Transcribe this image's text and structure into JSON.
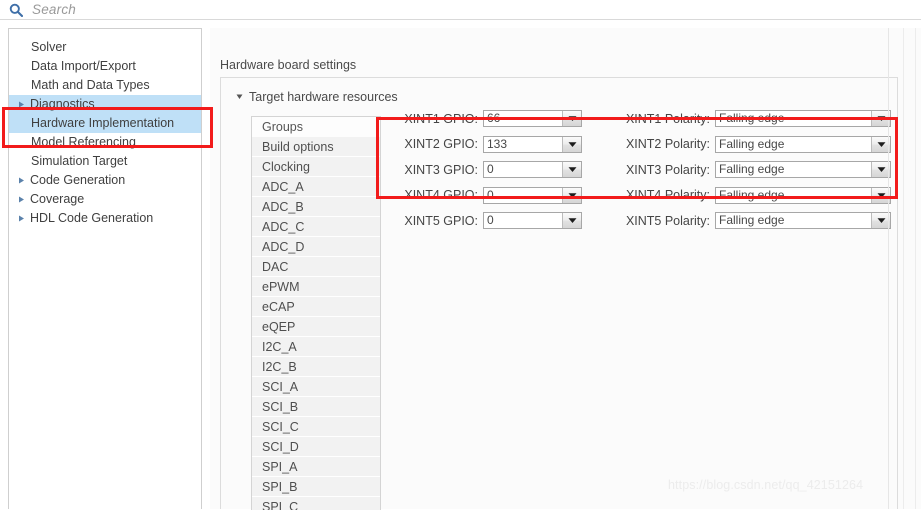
{
  "search": {
    "placeholder": "Search",
    "icon": "search-icon"
  },
  "sidebar": {
    "items": [
      {
        "label": "Solver",
        "expandable": false,
        "state": "normal"
      },
      {
        "label": "Data Import/Export",
        "expandable": false,
        "state": "normal"
      },
      {
        "label": "Math and Data Types",
        "expandable": false,
        "state": "normal"
      },
      {
        "label": "Diagnostics",
        "expandable": true,
        "state": "highlighted"
      },
      {
        "label": "Hardware Implementation",
        "expandable": false,
        "state": "selected"
      },
      {
        "label": "Model Referencing",
        "expandable": false,
        "state": "normal"
      },
      {
        "label": "Simulation Target",
        "expandable": false,
        "state": "normal"
      },
      {
        "label": "Code Generation",
        "expandable": true,
        "state": "normal"
      },
      {
        "label": "Coverage",
        "expandable": true,
        "state": "normal"
      },
      {
        "label": "HDL Code Generation",
        "expandable": true,
        "state": "normal"
      }
    ]
  },
  "main": {
    "section_title": "Hardware board settings",
    "subsection_title": "Target hardware resources",
    "subsection_expanded": true,
    "groups_label": "Groups",
    "groups": [
      "Build options",
      "Clocking",
      "ADC_A",
      "ADC_B",
      "ADC_C",
      "ADC_D",
      "DAC",
      "ePWM",
      "eCAP",
      "eQEP",
      "I2C_A",
      "I2C_B",
      "SCI_A",
      "SCI_B",
      "SCI_C",
      "SCI_D",
      "SPI_A",
      "SPI_B",
      "SPI_C"
    ],
    "settings_rows": [
      {
        "gpio_label": "XINT1 GPIO:",
        "gpio_value": "66",
        "polarity_label": "XINT1 Polarity:",
        "polarity_value": "Falling edge"
      },
      {
        "gpio_label": "XINT2 GPIO:",
        "gpio_value": "133",
        "polarity_label": "XINT2 Polarity:",
        "polarity_value": "Falling edge"
      },
      {
        "gpio_label": "XINT3 GPIO:",
        "gpio_value": "0",
        "polarity_label": "XINT3 Polarity:",
        "polarity_value": "Falling edge"
      },
      {
        "gpio_label": "XINT4 GPIO:",
        "gpio_value": "0",
        "polarity_label": "XINT4 Polarity:",
        "polarity_value": "Falling edge"
      },
      {
        "gpio_label": "XINT5 GPIO:",
        "gpio_value": "0",
        "polarity_label": "XINT5 Polarity:",
        "polarity_value": "Falling edge"
      }
    ]
  },
  "annotations": {
    "highlight_color": "#f21b1b",
    "selection_color": "#bfe0f7"
  },
  "watermark": {
    "text": "https://blog.csdn.net/qq_42151264"
  }
}
